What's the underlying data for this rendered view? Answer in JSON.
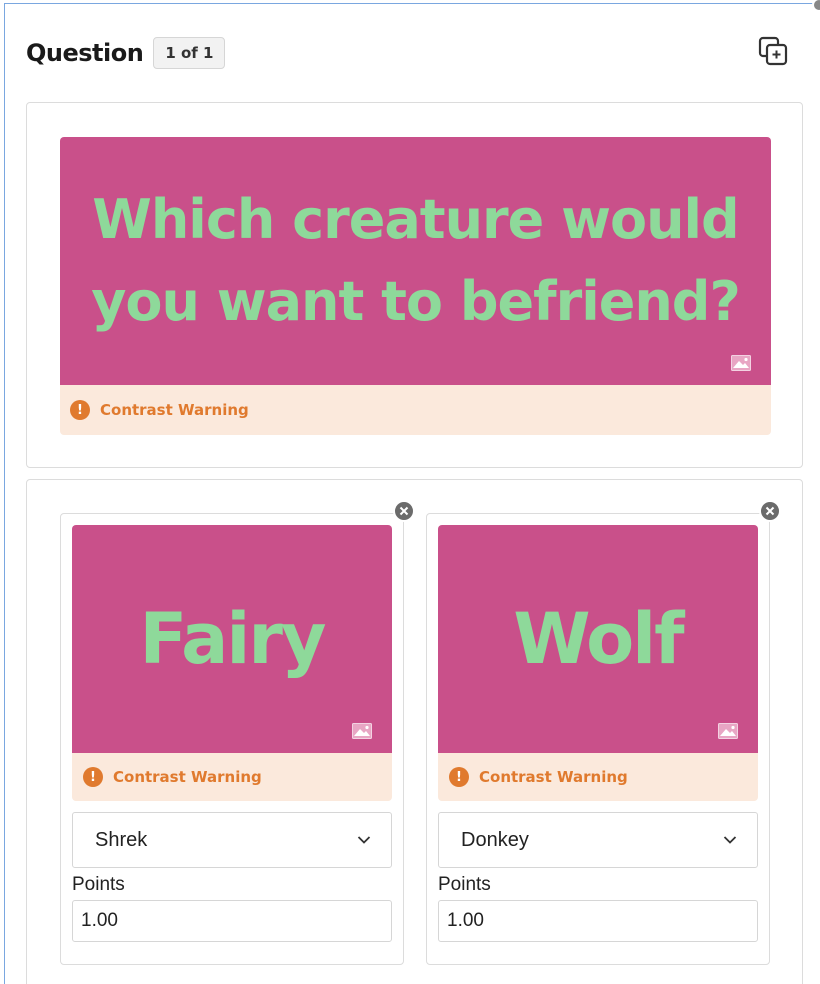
{
  "header": {
    "title": "Question",
    "badge": "1 of 1"
  },
  "question": {
    "text": "Which creature would you want to befriend?",
    "warning": "Contrast Warning",
    "tile_bg": "#c9508a",
    "tile_text_color": "#8ed99a"
  },
  "answers": [
    {
      "text": "Fairy",
      "warning": "Contrast Warning",
      "selected": "Shrek",
      "points_label": "Points",
      "points_value": "1.00"
    },
    {
      "text": "Wolf",
      "warning": "Contrast Warning",
      "selected": "Donkey",
      "points_label": "Points",
      "points_value": "1.00"
    }
  ],
  "colors": {
    "warning_bg": "#fbe9dc",
    "warning_text": "#e07a2e"
  },
  "icons": {
    "copy": "copy-add-icon",
    "image": "image-icon",
    "remove": "close-circle-icon",
    "warning": "exclamation-circle-icon",
    "dropdown": "chevron-down-icon"
  }
}
